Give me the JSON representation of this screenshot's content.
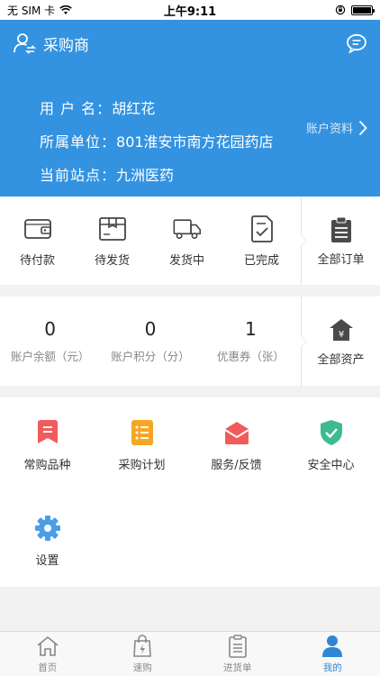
{
  "status_bar": {
    "carrier": "无 SIM 卡",
    "time": "上午9:11"
  },
  "header": {
    "title": "采购商",
    "user_label": "用 户 名：",
    "user_value": "胡红花",
    "unit_label": "所属单位：",
    "unit_value": "801淮安市南方花园药店",
    "site_label": "当前站点：",
    "site_value": "九洲医药",
    "account_link": "账户资料"
  },
  "orders": {
    "items": [
      {
        "label": "待付款",
        "icon": "wallet-icon"
      },
      {
        "label": "待发货",
        "icon": "package-icon"
      },
      {
        "label": "发货中",
        "icon": "truck-icon"
      },
      {
        "label": "已完成",
        "icon": "done-doc-icon"
      }
    ],
    "all_label": "全部订单"
  },
  "assets": {
    "items": [
      {
        "value": "0",
        "label": "账户余额（元）"
      },
      {
        "value": "0",
        "label": "账户积分（分）"
      },
      {
        "value": "1",
        "label": "优惠券（张）"
      }
    ],
    "all_label": "全部资产"
  },
  "services": {
    "items": [
      {
        "label": "常购品种",
        "icon": "bookmark-icon",
        "color": "#f25b5b"
      },
      {
        "label": "采购计划",
        "icon": "list-icon",
        "color": "#f6a623"
      },
      {
        "label": "服务/反馈",
        "icon": "mail-icon",
        "color": "#f25b5b"
      },
      {
        "label": "安全中心",
        "icon": "shield-icon",
        "color": "#3dbb8f"
      },
      {
        "label": "设置",
        "icon": "gear-icon",
        "color": "#4a9ee8"
      }
    ]
  },
  "tabbar": {
    "tabs": [
      {
        "label": "首页",
        "icon": "home-icon"
      },
      {
        "label": "速购",
        "icon": "bag-icon"
      },
      {
        "label": "进货单",
        "icon": "clipboard-icon"
      },
      {
        "label": "我的",
        "icon": "person-icon"
      }
    ],
    "active_index": 3
  },
  "colors": {
    "header_bg": "#3393e0",
    "active_tab": "#2f86d6"
  }
}
